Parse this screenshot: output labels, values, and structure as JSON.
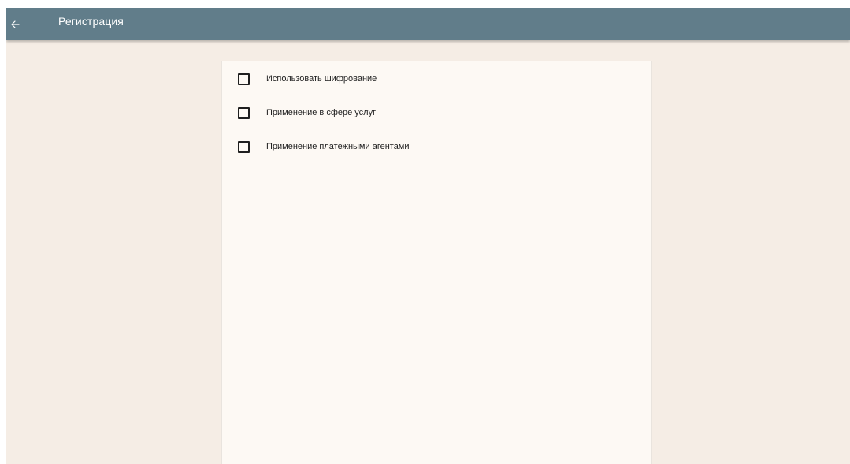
{
  "app_bar": {
    "back_icon": "arrow-left-icon",
    "title": "Регистрация",
    "background": "#617d8a"
  },
  "options": [
    {
      "label": "Использовать шифрование",
      "checked": false
    },
    {
      "label": "Применение в сфере услуг",
      "checked": false
    },
    {
      "label": "Применение платежными агентами",
      "checked": false
    }
  ]
}
